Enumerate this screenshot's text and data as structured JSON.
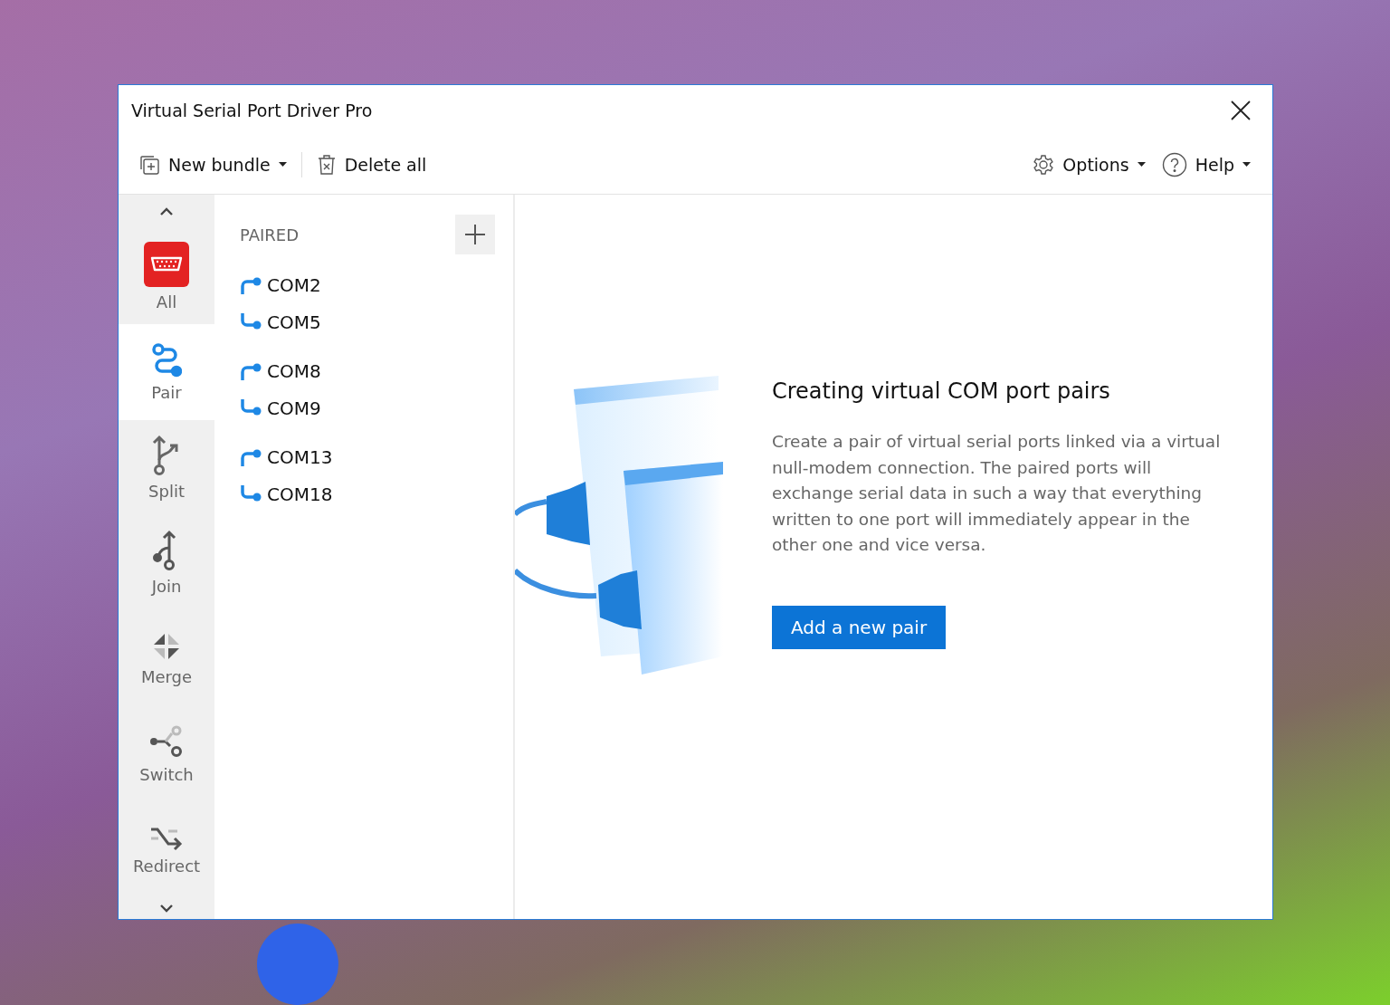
{
  "window": {
    "title": "Virtual Serial Port Driver Pro"
  },
  "toolbar": {
    "left": [
      {
        "label": "New bundle",
        "kind": "new",
        "dropdown": true
      },
      {
        "label": "Delete all",
        "kind": "delete",
        "dropdown": false
      }
    ],
    "right": [
      {
        "label": "Options",
        "kind": "options",
        "dropdown": true
      },
      {
        "label": "Help",
        "kind": "help",
        "dropdown": true
      }
    ]
  },
  "sidebar": {
    "items": [
      {
        "label": "All",
        "kind": "all",
        "selected": false
      },
      {
        "label": "Pair",
        "kind": "pair",
        "selected": true
      },
      {
        "label": "Split",
        "kind": "split",
        "selected": false
      },
      {
        "label": "Join",
        "kind": "join",
        "selected": false
      },
      {
        "label": "Merge",
        "kind": "merge",
        "selected": false
      },
      {
        "label": "Switch",
        "kind": "switch",
        "selected": false
      },
      {
        "label": "Redirect",
        "kind": "redirect",
        "selected": false
      }
    ]
  },
  "list": {
    "heading": "PAIRED",
    "pairs": [
      {
        "ports": [
          "COM2",
          "COM5"
        ]
      },
      {
        "ports": [
          "COM8",
          "COM9"
        ]
      },
      {
        "ports": [
          "COM13",
          "COM18"
        ]
      }
    ]
  },
  "content": {
    "title": "Creating virtual COM port pairs",
    "body": "Create a pair of virtual serial ports linked via a virtual null-modem connection. The paired ports will exchange serial data in such a way that everything written to one port will immediately appear in the other one and vice versa.",
    "button": "Add a new pair"
  }
}
